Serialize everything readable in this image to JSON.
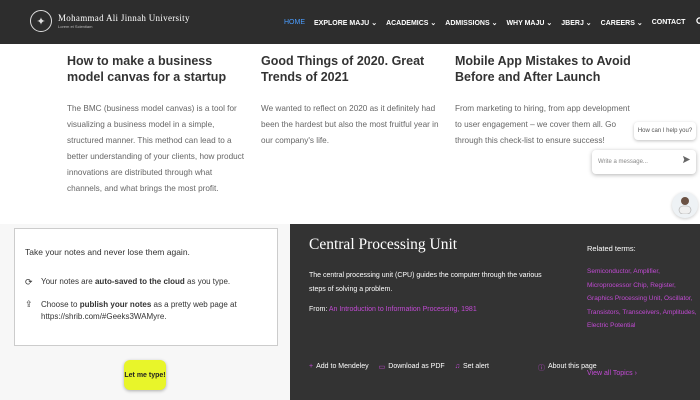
{
  "header": {
    "logo_seal": "✦",
    "logo_name": "Mohammad Ali Jinnah University",
    "logo_tagline": "Lorem et Scientiam"
  },
  "nav": {
    "items": [
      "HOME",
      "EXPLORE MAJU",
      "ACADEMICS",
      "ADMISSIONS",
      "WHY MAJU",
      "JBERJ",
      "CAREERS",
      "CONTACT"
    ],
    "dropdown_suffix": "⌄",
    "search_icon": "search-icon",
    "active_color": "#4a9dff"
  },
  "articles": [
    {
      "title": "How to make a business model canvas for a startup",
      "body": "The BMC (business model canvas) is a tool for visualizing a business model in a simple, structured manner. This method can lead to a better understanding of your clients, how product innovations are distributed through what channels, and what brings the most profit."
    },
    {
      "title": "Good Things of 2020. Great Trends of 2021",
      "body": "We wanted to reflect on 2020 as it definitely had been the hardest but also the most fruitful year in our company's life."
    },
    {
      "title": "Mobile App Mistakes to Avoid Before and After Launch",
      "body": "From marketing to hiring, from app development to user engagement – we cover them all. Go through this check-list to ensure success!"
    }
  ],
  "chat": {
    "tooltip": "How can I help you?",
    "input_placeholder": "Write a message...",
    "send_icon": "send-icon",
    "avatar_icon": "avatar-icon"
  },
  "notes": {
    "title": "Take your notes and never lose them again.",
    "row1_prefix": "Your notes are",
    "row1_bold": "auto-saved to the cloud",
    "row1_suffix": "as you type.",
    "row2_prefix": "Choose to",
    "row2_bold": "publish your notes",
    "row2_suffix": "as a pretty web page at",
    "row2_url": "https://shrib.com/#Geeks3WAMyre.",
    "cta_label": "Let me type!",
    "cta_color": "#e8f52a"
  },
  "cpu": {
    "title": "Central Processing Unit",
    "description": "The central processing unit (CPU) guides the computer through the various steps of solving a problem.",
    "from_label": "From:",
    "from_link": "An Introduction to Information Processing, 1981",
    "actions": [
      "Add to Mendeley",
      "Download as PDF",
      "Set alert"
    ],
    "about": "About this page",
    "related_title": "Related terms:",
    "related_terms": "Semiconductor, Amplifier, Microprocessor Chip, Register, Graphics Processing Unit, Oscillator, Transistors, Transceivers, Amplitudes, Electric Potential",
    "see_all": "View all Topics ›",
    "accent_color": "#c24ad4"
  }
}
